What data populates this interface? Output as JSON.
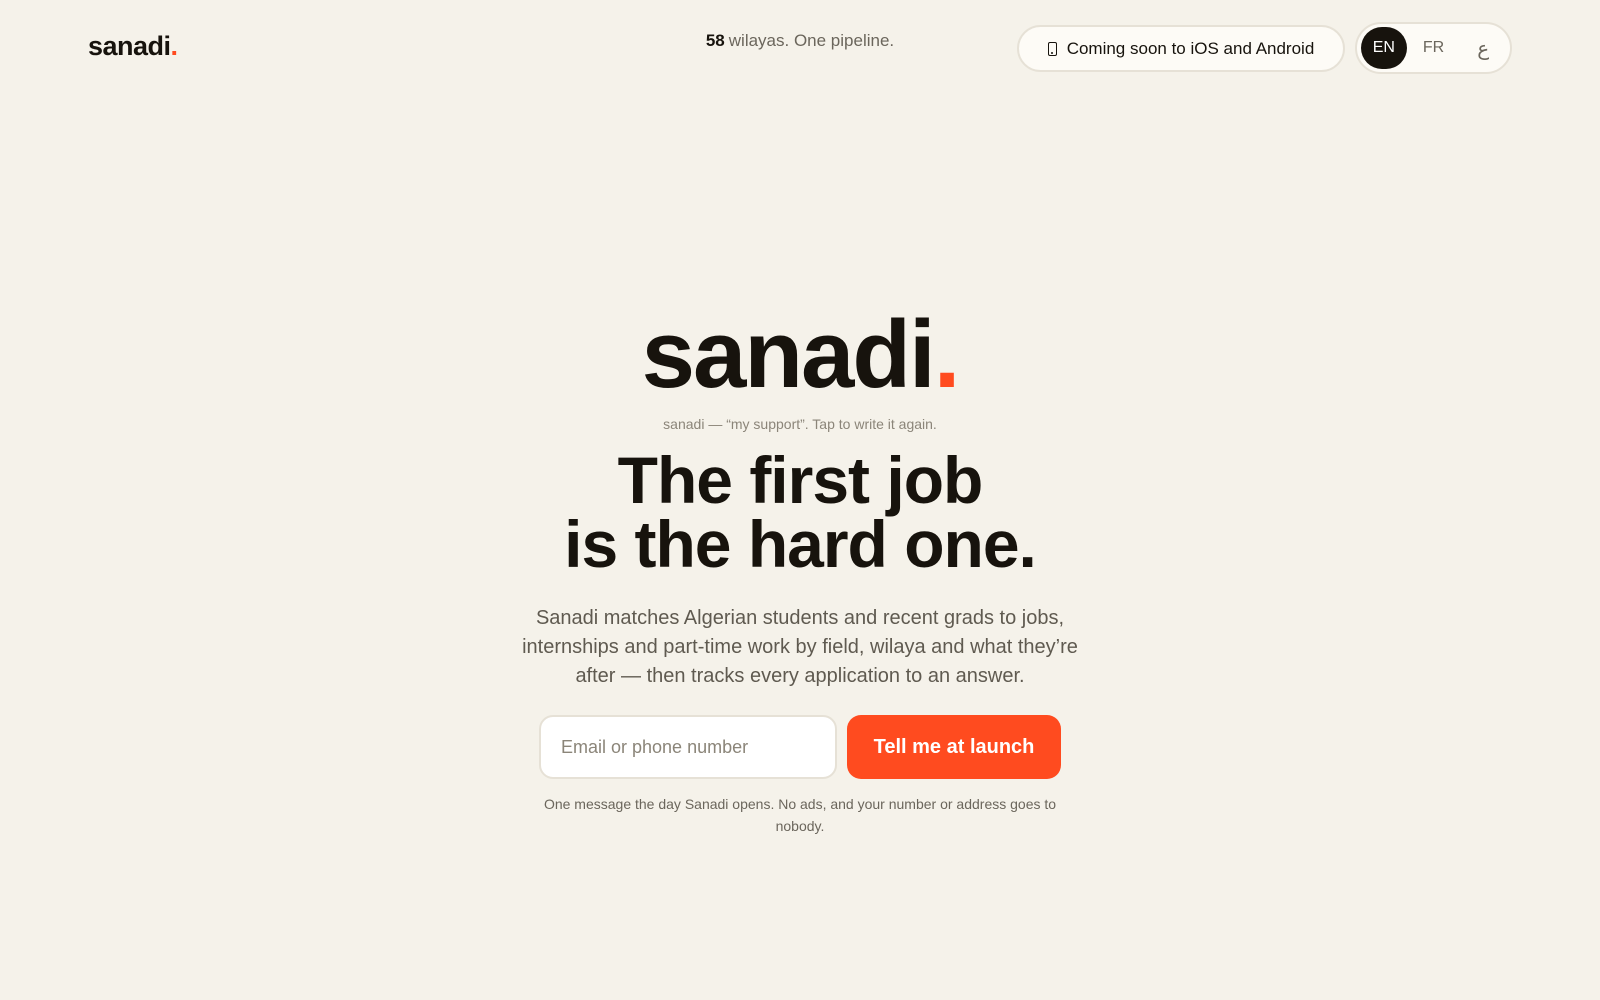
{
  "header": {
    "brand_name": "sanadi",
    "brand_dot": ".",
    "tagline_number": "58",
    "tagline_text": "wilayas. One pipeline.",
    "store_label": "Coming soon to iOS and Android",
    "store_icon": "phone-icon",
    "languages": [
      {
        "label": "EN",
        "active": true
      },
      {
        "label": "FR",
        "active": false
      },
      {
        "label": "ع",
        "active": false
      }
    ]
  },
  "hero": {
    "logo_text": "sanadi",
    "logo_dot": ".",
    "note": "sanadi — “my support”. Tap to write it again.",
    "headline_line1": "The first job",
    "headline_line2": "is the hard one.",
    "subcopy": "Sanadi matches Algerian students and recent grads to jobs, internships and part-time work by field, wilaya and what they’re after — then tracks every application to an answer.",
    "input_value": "",
    "input_placeholder": "Email or phone number",
    "cta_label": "Tell me at launch",
    "fineprint": "One message the day Sanadi opens. No ads, and your number or address goes to nobody."
  },
  "colors": {
    "background": "#f5f2ea",
    "accent": "#ff4b1f",
    "text": "#17130d",
    "muted": "#6b665c"
  }
}
